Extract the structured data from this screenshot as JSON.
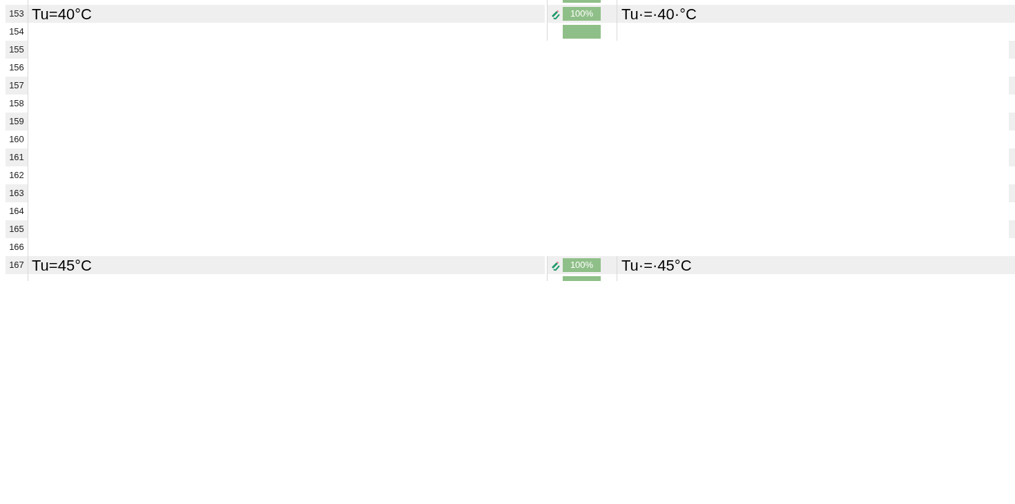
{
  "rows": [
    {
      "kind": "cut"
    },
    {
      "kind": "segment",
      "number": "153",
      "source": "Tu=40°C",
      "match": "100%",
      "target": "Tu·=·40·°C"
    },
    {
      "kind": "cut",
      "number": "154"
    },
    {
      "kind": "blank",
      "number": "155"
    },
    {
      "kind": "blank",
      "number": "156"
    },
    {
      "kind": "blank",
      "number": "157"
    },
    {
      "kind": "blank",
      "number": "158"
    },
    {
      "kind": "blank",
      "number": "159"
    },
    {
      "kind": "blank",
      "number": "160"
    },
    {
      "kind": "blank",
      "number": "161"
    },
    {
      "kind": "blank",
      "number": "162"
    },
    {
      "kind": "blank",
      "number": "163"
    },
    {
      "kind": "blank",
      "number": "164"
    },
    {
      "kind": "blank",
      "number": "165"
    },
    {
      "kind": "blank",
      "number": "166"
    },
    {
      "kind": "segment",
      "number": "167",
      "source": "Tu=45°C",
      "match": "100%",
      "target": "Tu·=·45°C"
    },
    {
      "kind": "cut"
    }
  ]
}
